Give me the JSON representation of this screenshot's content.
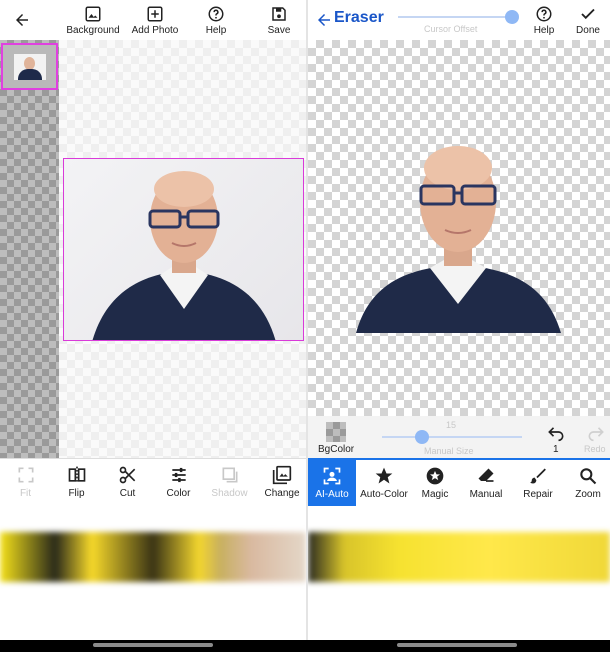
{
  "left": {
    "topbar": {
      "back_icon": "arrow-left-icon",
      "items": [
        {
          "label": "Background",
          "icon": "image-icon"
        },
        {
          "label": "Add Photo",
          "icon": "add-photo-icon"
        },
        {
          "label": "Help",
          "icon": "help-icon"
        },
        {
          "label": "Save",
          "icon": "save-icon"
        }
      ]
    },
    "toolbar": [
      {
        "label": "Fit",
        "icon": "fit-icon",
        "disabled": true
      },
      {
        "label": "Flip",
        "icon": "flip-icon"
      },
      {
        "label": "Cut",
        "icon": "scissors-icon"
      },
      {
        "label": "Color",
        "icon": "sliders-icon"
      },
      {
        "label": "Shadow",
        "icon": "shadow-icon",
        "disabled": true
      },
      {
        "label": "Change",
        "icon": "change-image-icon"
      }
    ]
  },
  "right": {
    "title": "Eraser",
    "cursor_offset_label": "Cursor Offset",
    "help_label": "Help",
    "done_label": "Done",
    "bgcolor_label": "BgColor",
    "manual_size_value": "15",
    "manual_size_label": "Manual Size",
    "undo_count": "1",
    "redo_label": "Redo",
    "modes": [
      {
        "label": "AI-Auto",
        "icon": "ai-scan-icon",
        "active": true
      },
      {
        "label": "Auto-Color",
        "icon": "star-icon"
      },
      {
        "label": "Magic",
        "icon": "magic-star-icon"
      },
      {
        "label": "Manual",
        "icon": "eraser-icon"
      },
      {
        "label": "Repair",
        "icon": "brush-icon"
      },
      {
        "label": "Zoom",
        "icon": "search-icon"
      }
    ]
  },
  "colors": {
    "accent": "#1a73e8",
    "title": "#1a56c8",
    "selection": "#e040e0"
  }
}
